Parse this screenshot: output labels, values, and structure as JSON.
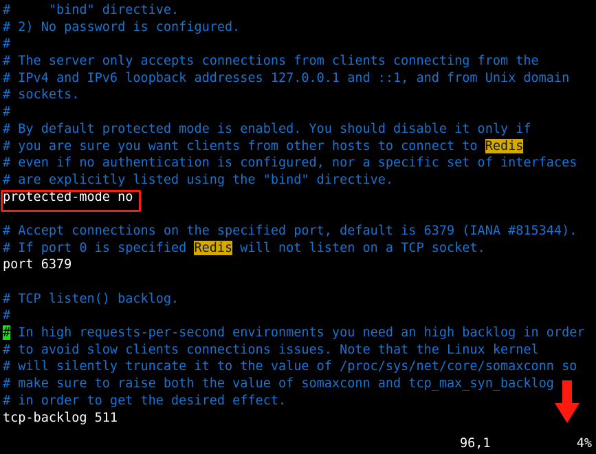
{
  "app": {
    "type": "terminal-text-editor",
    "editor": "vim",
    "background_color": "#000000",
    "comment_color": "#1874d2",
    "code_color": "#ffffff",
    "search_highlight_bg": "#d4aa00",
    "search_highlight_fg": "#1a1a1a",
    "cursor_bg": "#17e017",
    "annotation_color": "#ff1a10"
  },
  "buffer": {
    "search_term": "Redis",
    "lines": [
      {
        "tokens": [
          {
            "t": "#     \"bind\" directive.",
            "k": "comment"
          }
        ]
      },
      {
        "tokens": [
          {
            "t": "# 2) No password is configured.",
            "k": "comment"
          }
        ]
      },
      {
        "tokens": [
          {
            "t": "#",
            "k": "comment"
          }
        ]
      },
      {
        "tokens": [
          {
            "t": "# The server only accepts connections from clients connecting from the",
            "k": "comment"
          }
        ]
      },
      {
        "tokens": [
          {
            "t": "# IPv4 and IPv6 loopback addresses 127.0.0.1 and ::1, and from Unix domain",
            "k": "comment"
          }
        ]
      },
      {
        "tokens": [
          {
            "t": "# sockets.",
            "k": "comment"
          }
        ]
      },
      {
        "tokens": [
          {
            "t": "#",
            "k": "comment"
          }
        ]
      },
      {
        "tokens": [
          {
            "t": "# By default protected mode is enabled. You should disable it only if",
            "k": "comment"
          }
        ]
      },
      {
        "tokens": [
          {
            "t": "# you are sure you want clients from other hosts to connect to ",
            "k": "comment"
          },
          {
            "t": "Redis",
            "k": "search"
          }
        ]
      },
      {
        "tokens": [
          {
            "t": "# even if no authentication is configured, nor a specific set of interfaces",
            "k": "comment"
          }
        ]
      },
      {
        "tokens": [
          {
            "t": "# are explicitly listed using the \"bind\" directive.",
            "k": "comment"
          }
        ]
      },
      {
        "tokens": [
          {
            "t": "protected-mode no",
            "k": "plain"
          }
        ]
      },
      {
        "tokens": [
          {
            "t": "",
            "k": "comment"
          }
        ]
      },
      {
        "tokens": [
          {
            "t": "# Accept connections on the specified port, default is 6379 (IANA #815344).",
            "k": "comment"
          }
        ]
      },
      {
        "tokens": [
          {
            "t": "# If port 0 is specified ",
            "k": "comment"
          },
          {
            "t": "Redis",
            "k": "search"
          },
          {
            "t": " will not listen on a TCP socket.",
            "k": "comment"
          }
        ]
      },
      {
        "tokens": [
          {
            "t": "port 6379",
            "k": "plain"
          }
        ]
      },
      {
        "tokens": [
          {
            "t": "",
            "k": "comment"
          }
        ]
      },
      {
        "tokens": [
          {
            "t": "# TCP listen() backlog.",
            "k": "comment"
          }
        ]
      },
      {
        "tokens": [
          {
            "t": "#",
            "k": "comment"
          }
        ]
      },
      {
        "tokens": [
          {
            "t": "#",
            "k": "cursor"
          },
          {
            "t": " In high requests-per-second environments you need an high backlog in order",
            "k": "comment"
          }
        ]
      },
      {
        "tokens": [
          {
            "t": "# to avoid slow clients connections issues. Note that the Linux kernel",
            "k": "comment"
          }
        ]
      },
      {
        "tokens": [
          {
            "t": "# will silently truncate it to the value of /proc/sys/net/core/somaxconn so",
            "k": "comment"
          }
        ]
      },
      {
        "tokens": [
          {
            "t": "# make sure to raise both the value of somaxconn and tcp_max_syn_backlog",
            "k": "comment"
          }
        ]
      },
      {
        "tokens": [
          {
            "t": "# in order to get the desired effect.",
            "k": "comment"
          }
        ]
      },
      {
        "tokens": [
          {
            "t": "tcp-backlog 511",
            "k": "plain"
          }
        ]
      }
    ]
  },
  "status_line": {
    "position": "96,1",
    "percent": "4%"
  },
  "annotations": {
    "highlight_box": {
      "name": "protected-mode-highlight-box",
      "target_text": "protected-mode no",
      "color": "#ff1a10"
    },
    "arrow": {
      "name": "percent-indicator-arrow",
      "direction": "down",
      "target_text": "4%",
      "color": "#ff1a10"
    }
  }
}
